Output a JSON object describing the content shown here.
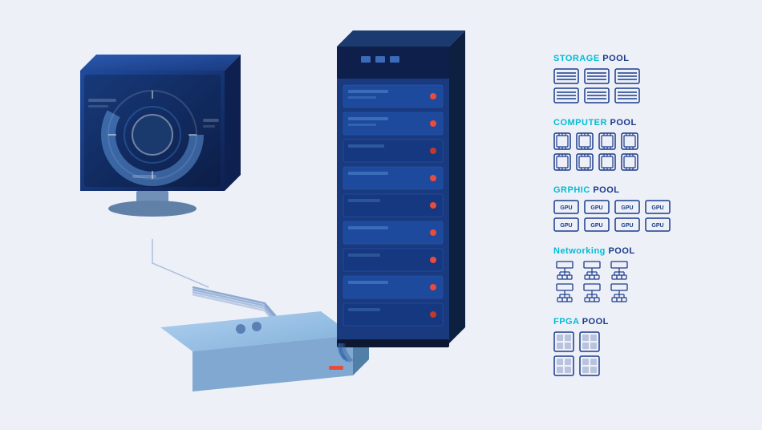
{
  "pools": [
    {
      "id": "storage",
      "label": "STORAGE",
      "label_suffix": " POOL",
      "icon_type": "hdd",
      "rows": 2,
      "cols": 3
    },
    {
      "id": "computer",
      "label": "COMPUTER",
      "label_suffix": " POOL",
      "icon_type": "cpu",
      "rows": 2,
      "cols": 4
    },
    {
      "id": "graphic",
      "label": "GRPHIC",
      "label_suffix": " POOL",
      "icon_type": "gpu",
      "rows": 2,
      "cols": 4
    },
    {
      "id": "networking",
      "label": "Networking",
      "label_suffix": " POOL",
      "icon_type": "network",
      "rows": 2,
      "cols": 3
    },
    {
      "id": "fpga",
      "label": "FPGA",
      "label_suffix": " POOL",
      "icon_type": "fpga",
      "rows": 2,
      "cols": 2
    }
  ],
  "colors": {
    "bg": "#eef0f8",
    "accent": "#00bcd4",
    "dark_blue": "#1a3a8a",
    "server_blue": "#1e4499",
    "light_blue": "#c0d8f0"
  }
}
